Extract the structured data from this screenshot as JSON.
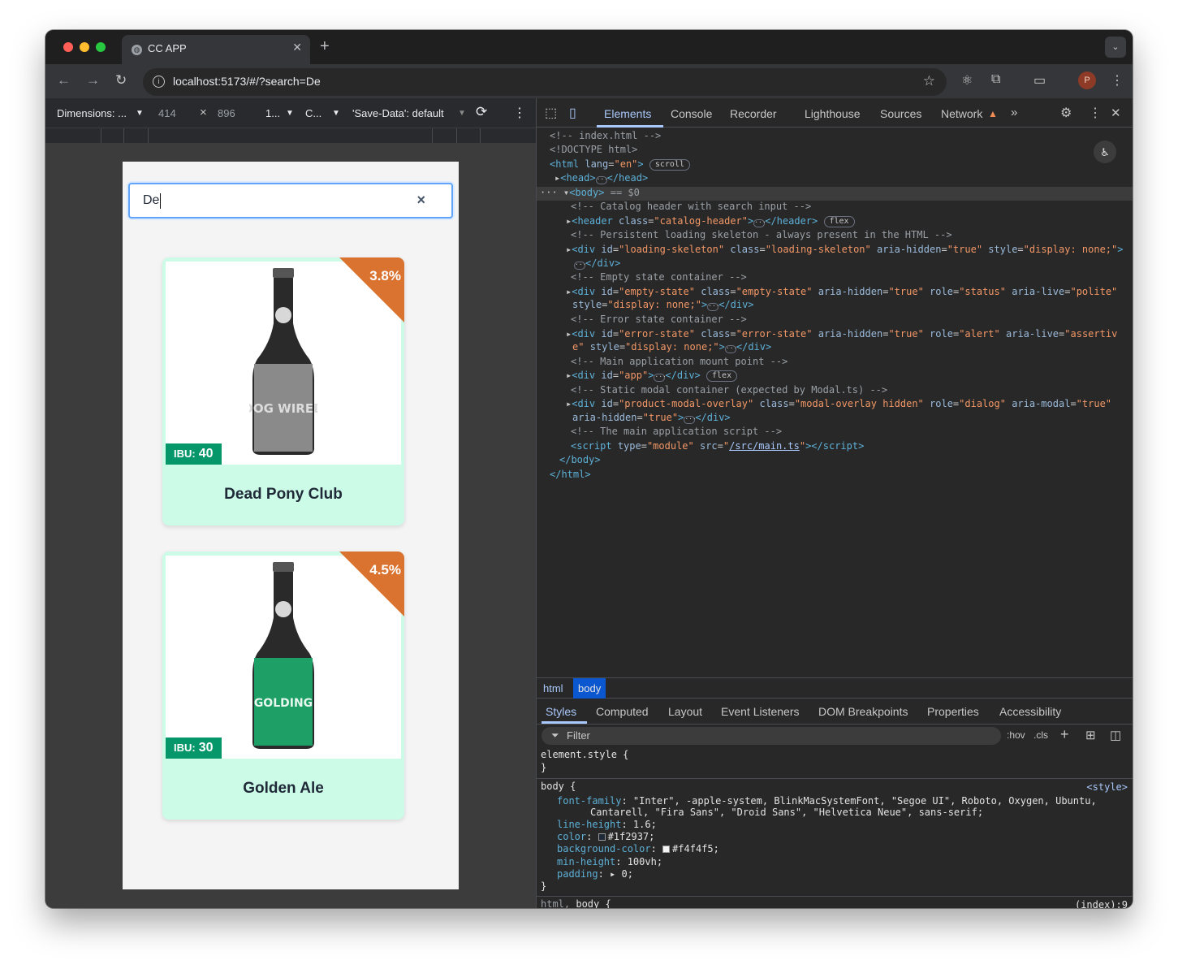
{
  "browser": {
    "tab_title": "CC APP",
    "url": "localhost:5173/#/?search=De"
  },
  "device_toolbar": {
    "dimensions_label": "Dimensions: ...",
    "width": "414",
    "times": "×",
    "height": "896",
    "zoom": "1...",
    "throttle": "C...",
    "save_data": "'Save-Data': default"
  },
  "app": {
    "search_value": "De",
    "clear_symbol": "×",
    "products": [
      {
        "name": "Dead Pony Club",
        "abv": "3.8%",
        "ibu_label": "IBU:",
        "ibu": "40",
        "label_text": "DOG WIRED",
        "label_color": "#8a8a8a"
      },
      {
        "name": "Golden Ale",
        "abv": "4.5%",
        "ibu_label": "IBU:",
        "ibu": "30",
        "label_text": "GOLDING",
        "label_color": "#1e9f66"
      }
    ]
  },
  "devtools": {
    "tabs": [
      "Elements",
      "Console",
      "Recorder",
      "Lighthouse",
      "Sources",
      "Network"
    ],
    "active_tab": "Elements",
    "breadcrumb": [
      "html",
      "body"
    ],
    "subtabs": [
      "Styles",
      "Computed",
      "Layout",
      "Event Listeners",
      "DOM Breakpoints",
      "Properties",
      "Accessibility"
    ],
    "filter_placeholder": "Filter",
    "hov": ":hov",
    "cls": ".cls",
    "style_source": "<style>",
    "index_source": "(index):9"
  }
}
